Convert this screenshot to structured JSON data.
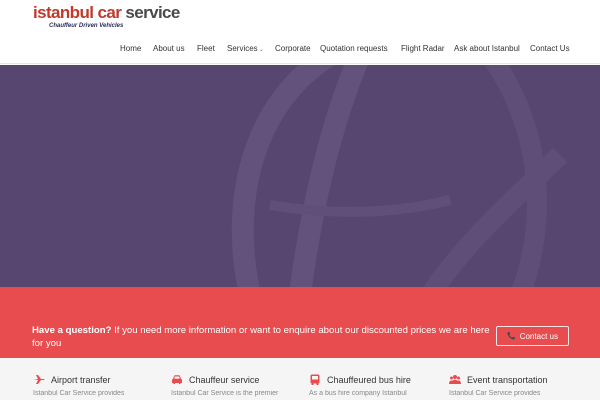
{
  "logo": {
    "word1": "istanbul",
    "word2": "car",
    "word3": "service",
    "tagline": "Chauffeur Driven Vehicles"
  },
  "nav": {
    "items": [
      {
        "label": "Home"
      },
      {
        "label": "About us"
      },
      {
        "label": "Fleet"
      },
      {
        "label": "Services",
        "caret": "⌄"
      },
      {
        "label": "Corporate"
      },
      {
        "label": "Quotation requests"
      },
      {
        "label": "Flight Radar"
      },
      {
        "label": "Ask about Istanbul"
      },
      {
        "label": "Contact Us"
      }
    ]
  },
  "hero": {
    "background": "#574670"
  },
  "cta": {
    "question": "Have a question?",
    "text": " If you need more information or want to enquire about our discounted prices we are here for you",
    "button_label": "Contact us",
    "button_icon": "phone-icon",
    "background": "#e84c4f"
  },
  "services": [
    {
      "title": "Airport transfer",
      "icon": "airplane-icon",
      "desc": "Istanbul Car Service provides"
    },
    {
      "title": "Chauffeur service",
      "icon": "car-icon",
      "desc": "Istanbul Car Service is the premier"
    },
    {
      "title": "Chauffeured bus hire",
      "icon": "bus-icon",
      "desc": "As a bus hire company Istanbul"
    },
    {
      "title": "Event transportation",
      "icon": "group-icon",
      "desc": "Istanbul Car Service provides"
    }
  ],
  "colors": {
    "accent": "#e84c4f",
    "brand_red": "#c0392b",
    "hero_purple": "#574670"
  }
}
